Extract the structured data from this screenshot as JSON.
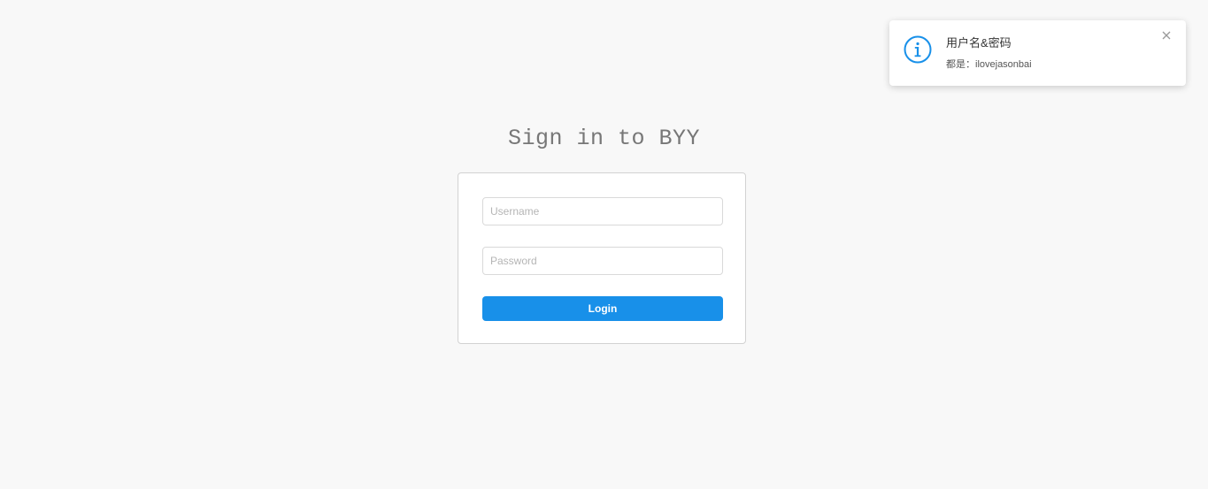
{
  "page": {
    "title": "Sign in to BYY"
  },
  "login_form": {
    "username_placeholder": "Username",
    "username_value": "",
    "password_placeholder": "Password",
    "password_value": "",
    "login_label": "Login"
  },
  "notification": {
    "icon": "info-circle-icon",
    "title": "用户名&密码",
    "description": "都是：ilovejasonbai",
    "close_icon": "close-icon"
  },
  "colors": {
    "background": "#f8f8f8",
    "primary": "#1890e9",
    "info_icon": "#1890e9",
    "title_text": "#777777"
  }
}
